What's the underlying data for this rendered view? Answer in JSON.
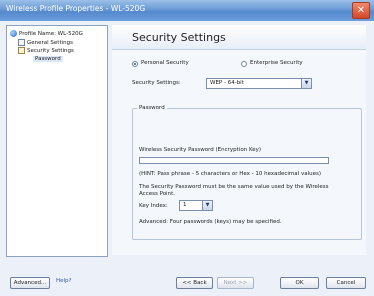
{
  "window": {
    "title": "Wireless Profile Properties - WL-520G",
    "close_glyph": "✕"
  },
  "tree": {
    "items": [
      {
        "label": "Profile Name: WL-520G",
        "icon": "globe-icon"
      },
      {
        "label": "General Settings",
        "icon": "page-icon"
      },
      {
        "label": "Security Settings",
        "icon": "lock-page-icon"
      },
      {
        "label": "Password",
        "icon": ""
      }
    ]
  },
  "main": {
    "heading": "Security Settings",
    "mode": {
      "personal_label": "Personal Security",
      "enterprise_label": "Enterprise Security",
      "selected": "personal"
    },
    "security_settings": {
      "label": "Security Settings:",
      "value": "WEP - 64-bit"
    },
    "password": {
      "group_title": "Password",
      "field_label": "Wireless Security Password (Encryption Key)",
      "field_value": "",
      "hint": "(HINT: Pass phrase - 5 characters or Hex - 10 hexadecimal values)",
      "note": "The Security Password must be the same value used by the Wireless Access Point.",
      "key_index_label": "Key Index:",
      "key_index_value": "1",
      "advanced_note": "Advanced: Four passwords (keys) may be specified."
    }
  },
  "footer": {
    "advanced": "Advanced...",
    "help": "Help?",
    "back": "<< Back",
    "next": "Next >>",
    "ok": "OK",
    "cancel": "Cancel"
  }
}
